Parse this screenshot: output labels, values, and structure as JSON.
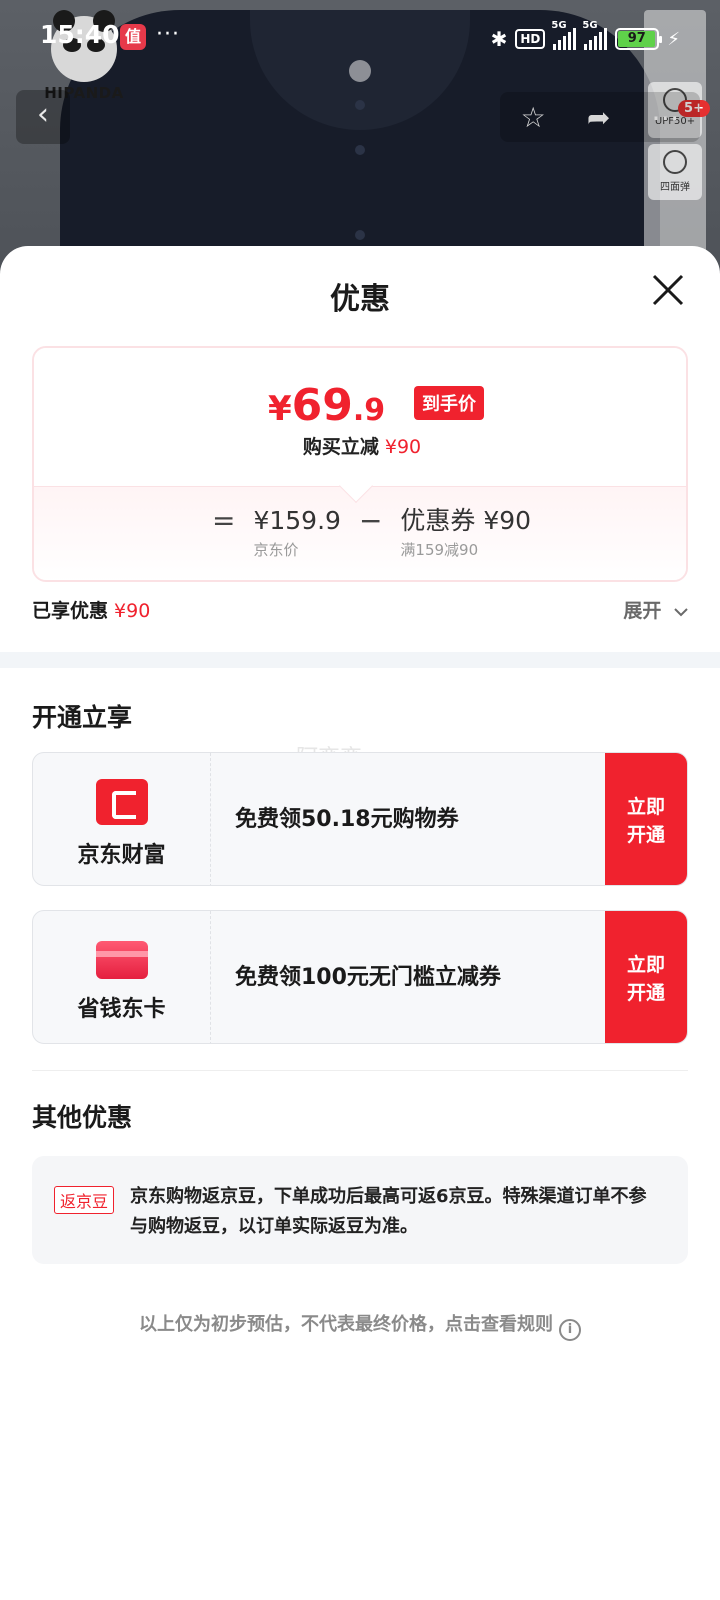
{
  "status_bar": {
    "time": "15:40",
    "app_badge": "值",
    "dots": "···",
    "hd": "HD",
    "net1": "5G",
    "net2": "5G",
    "battery": "97"
  },
  "product_bg": {
    "brand_name": "HIPANDA",
    "side_badge": "5+",
    "side_tags": [
      "UPF50+",
      "四面弹"
    ]
  },
  "sheet": {
    "title": "优惠",
    "price_card": {
      "currency": "¥",
      "final_int": "69",
      "final_dec": ".9",
      "badge": "到手价",
      "discount_label": "购买立减",
      "discount_value": "¥90",
      "eq": "=",
      "minus": "−",
      "jd_price": "¥159.9",
      "jd_price_label": "京东价",
      "coupon": "优惠券 ¥90",
      "coupon_rule": "满159减90"
    },
    "enjoyed_label": "已享优惠",
    "enjoyed_value": "¥90",
    "expand_label": "展开",
    "open_section": {
      "title": "开通立享",
      "watermark": "阿变变",
      "offers": [
        {
          "name": "京东财富",
          "text": "免费领50.18元购物券",
          "cta": "立即开通"
        },
        {
          "name": "省钱东卡",
          "text": "免费领100元无门槛立减券",
          "cta": "立即开通"
        }
      ]
    },
    "other_section": {
      "title": "其他优惠",
      "tag": "返京豆",
      "text": "京东购物返京豆，下单成功后最高可返6京豆。特殊渠道订单不参与购物返豆，以订单实际返豆为准。"
    },
    "footer_note": "以上仅为初步预估，不代表最终价格，点击查看规则"
  },
  "colors": {
    "accent": "#f0222e",
    "band": "#f2f5f8"
  }
}
